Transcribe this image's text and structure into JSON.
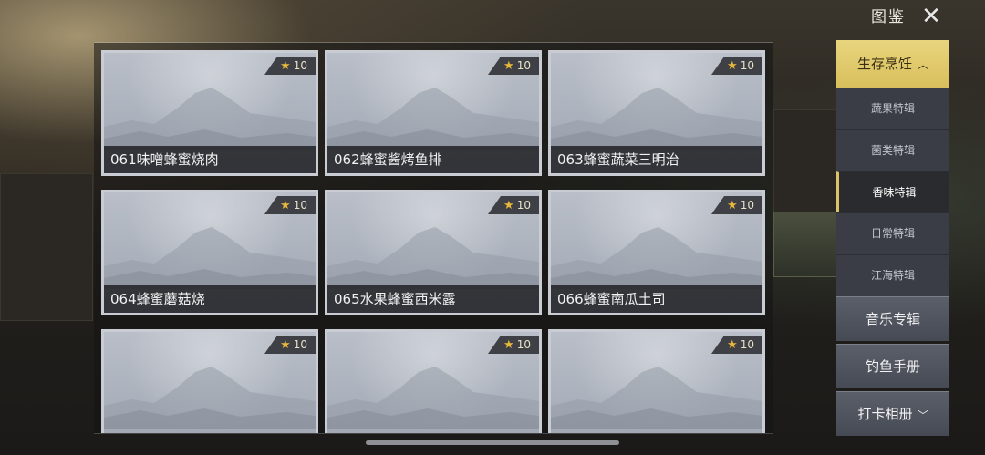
{
  "header": {
    "title": "图鉴",
    "close_icon": "close-icon"
  },
  "cards": [
    {
      "name": "061味噌蜂蜜烧肉",
      "stars": "10"
    },
    {
      "name": "062蜂蜜酱烤鱼排",
      "stars": "10"
    },
    {
      "name": "063蜂蜜蔬菜三明治",
      "stars": "10"
    },
    {
      "name": "064蜂蜜蘑菇烧",
      "stars": "10"
    },
    {
      "name": "065水果蜂蜜西米露",
      "stars": "10"
    },
    {
      "name": "066蜂蜜南瓜土司",
      "stars": "10"
    },
    {
      "name": "",
      "stars": "10"
    },
    {
      "name": "",
      "stars": "10"
    },
    {
      "name": "",
      "stars": "10"
    }
  ],
  "sidebar": {
    "active_category": "生存烹饪",
    "subitems": [
      "蔬果特辑",
      "菌类特辑",
      "香味特辑",
      "日常特辑",
      "江海特辑"
    ],
    "selected_subitem": "香味特辑",
    "categories": [
      "音乐专辑",
      "钓鱼手册",
      "打卡相册"
    ]
  },
  "colors": {
    "accent": "#d9bf5c",
    "card_frame": "#c9ccd3",
    "star": "#e8b83a"
  }
}
